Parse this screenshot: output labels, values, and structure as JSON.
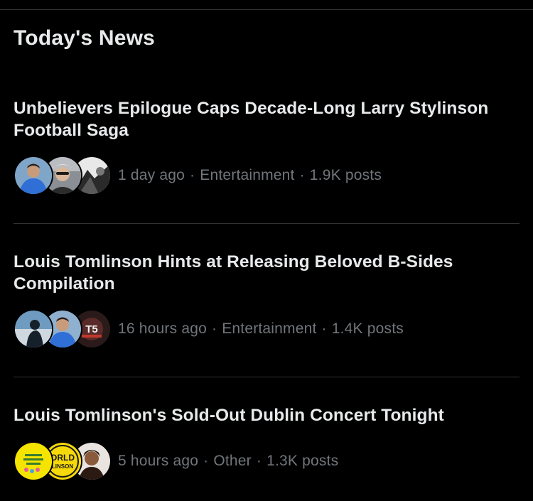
{
  "section": {
    "title": "Today's News"
  },
  "news": [
    {
      "headline": "Unbelievers Epilogue Caps Decade-Long Larry Stylinson Football Saga",
      "time": "1 day ago",
      "category": "Entertainment",
      "posts": "1.9K posts",
      "avatars": [
        "avatar-person-blue-hoodie",
        "avatar-person-sunglasses",
        "avatar-monochrome-photo"
      ]
    },
    {
      "headline": "Louis Tomlinson Hints at Releasing Beloved B-Sides Compilation",
      "time": "16 hours ago",
      "category": "Entertainment",
      "posts": "1.4K posts",
      "avatars": [
        "avatar-silhouette-blue",
        "avatar-person-blue-hoodie",
        "avatar-t5-logo"
      ]
    },
    {
      "headline": "Louis Tomlinson's Sold-Out Dublin Concert Tonight",
      "time": "5 hours ago",
      "category": "Other",
      "posts": "1.3K posts",
      "avatars": [
        "avatar-yellow-badge",
        "avatar-world-stylinson-logo",
        "avatar-person-portrait"
      ]
    }
  ],
  "avatar_badges": {
    "t5": "T5",
    "world": "ORLD",
    "world_sub": "LINSON"
  },
  "colors": {
    "background": "#000000",
    "text_primary": "#e7e9ea",
    "text_secondary": "#71767b",
    "divider": "#2f3336"
  }
}
